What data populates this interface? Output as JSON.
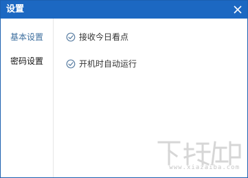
{
  "window": {
    "title": "设置",
    "close_icon": "close-icon"
  },
  "sidebar": {
    "items": [
      {
        "label": "基本设置",
        "active": true
      },
      {
        "label": "密码设置",
        "active": false
      }
    ]
  },
  "options": [
    {
      "label": "接收今日看点",
      "icon": "check-circle-icon",
      "checked": true
    },
    {
      "label": "开机时自动运行",
      "icon": "check-circle-icon",
      "checked": true
    }
  ],
  "watermark": {
    "text": "www.xiazaiba.com",
    "logo_text": "下载吧"
  },
  "colors": {
    "titlebar": "#1c68c2",
    "active_item": "#3c6e9e",
    "icon": "#5b7fa3"
  }
}
